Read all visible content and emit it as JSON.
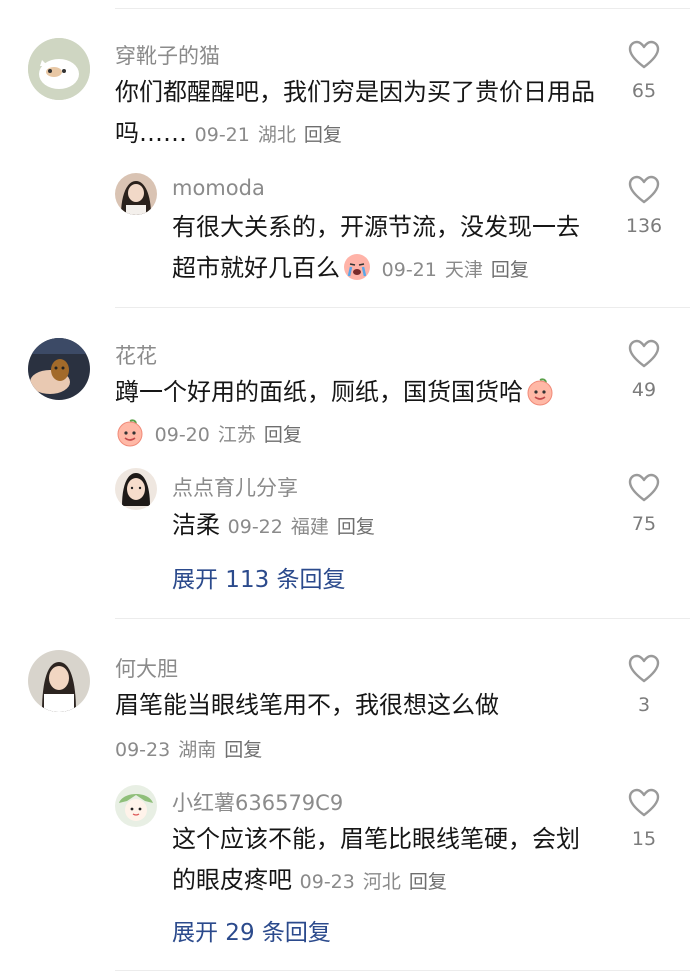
{
  "comments": [
    {
      "author": "穿靴子的猫",
      "text": "你们都醒醒吧，我们穷是因为买了贵价日用品吗……",
      "date": "09-21",
      "region": "湖北",
      "reply_label": "回复",
      "likes": "65",
      "replies": [
        {
          "author": "momoda",
          "text": "有很大关系的，开源节流，没发现一去超市就好几百么",
          "date": "09-21",
          "region": "天津",
          "reply_label": "回复",
          "likes": "136"
        }
      ]
    },
    {
      "author": "花花",
      "text": "蹲一个好用的面纸，厕纸，国货国货哈",
      "date": "09-20",
      "region": "江苏",
      "reply_label": "回复",
      "likes": "49",
      "replies": [
        {
          "author": "点点育儿分享",
          "text": "洁柔",
          "date": "09-22",
          "region": "福建",
          "reply_label": "回复",
          "likes": "75"
        }
      ],
      "expand_label": "展开 113 条回复"
    },
    {
      "author": "何大胆",
      "text": "眉笔能当眼线笔用不，我很想这么做",
      "date": "09-23",
      "region": "湖南",
      "reply_label": "回复",
      "likes": "3",
      "replies": [
        {
          "author": "小红薯636579C9",
          "text": "这个应该不能，眉笔比眼线笔硬，会划的眼皮疼吧",
          "date": "09-23",
          "region": "河北",
          "reply_label": "回复",
          "likes": "15"
        }
      ],
      "expand_label": "展开 29 条回复"
    }
  ],
  "colors": {
    "name": "#8b8b8b",
    "meta": "#8a8a8a",
    "expand": "#2b4a8c",
    "heart": "#9a9a9a"
  },
  "icons": [
    "heart-outline-icon",
    "crying-face-emoji",
    "peach-smile-emoji"
  ]
}
